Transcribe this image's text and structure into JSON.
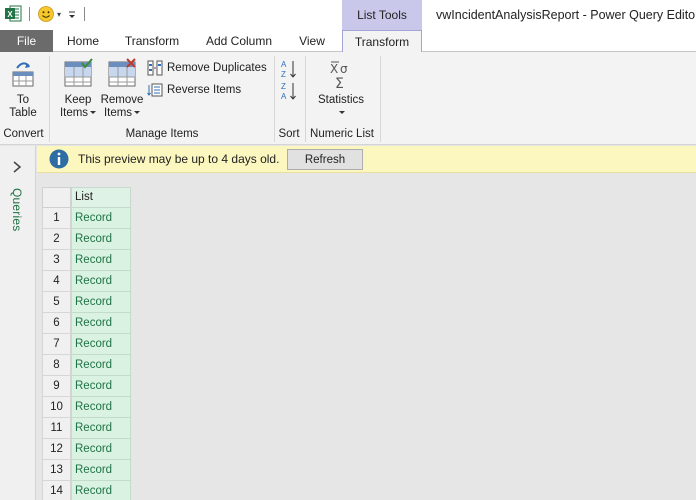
{
  "window": {
    "title": "vwIncidentAnalysisReport - Power Query Editor",
    "context_tab": "List Tools"
  },
  "tabs": {
    "file": "File",
    "home": "Home",
    "transform": "Transform",
    "add_column": "Add Column",
    "view": "View",
    "list_transform": "Transform"
  },
  "ribbon": {
    "to_table_line1": "To",
    "to_table_line2": "Table",
    "keep_items_line1": "Keep",
    "keep_items_line2": "Items",
    "remove_items_line1": "Remove",
    "remove_items_line2": "Items",
    "remove_duplicates": "Remove Duplicates",
    "reverse_items": "Reverse Items",
    "statistics": "Statistics",
    "groups": {
      "convert": "Convert",
      "manage_items": "Manage Items",
      "sort": "Sort",
      "numeric_list": "Numeric List"
    }
  },
  "queries_pane": {
    "label": "Queries"
  },
  "infobar": {
    "message": "This preview may be up to 4 days old.",
    "refresh_label": "Refresh"
  },
  "grid": {
    "column_header": "List",
    "rows": [
      {
        "num": "1",
        "value": "Record"
      },
      {
        "num": "2",
        "value": "Record"
      },
      {
        "num": "3",
        "value": "Record"
      },
      {
        "num": "4",
        "value": "Record"
      },
      {
        "num": "5",
        "value": "Record"
      },
      {
        "num": "6",
        "value": "Record"
      },
      {
        "num": "7",
        "value": "Record"
      },
      {
        "num": "8",
        "value": "Record"
      },
      {
        "num": "9",
        "value": "Record"
      },
      {
        "num": "10",
        "value": "Record"
      },
      {
        "num": "11",
        "value": "Record"
      },
      {
        "num": "12",
        "value": "Record"
      },
      {
        "num": "13",
        "value": "Record"
      },
      {
        "num": "14",
        "value": "Record"
      }
    ]
  },
  "colors": {
    "accent_green": "#217346",
    "context_tab": "#c9c8ea",
    "infobar": "#fcf6bf",
    "cell_fill": "#d9f2e2"
  }
}
